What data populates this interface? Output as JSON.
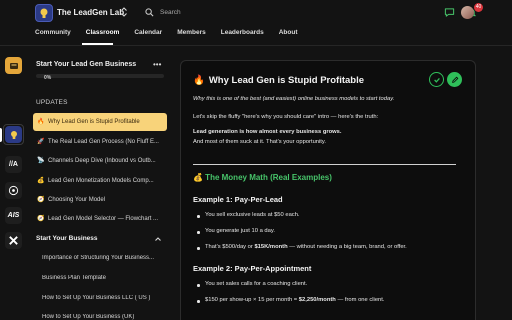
{
  "header": {
    "brand": "The LeadGen Lab",
    "search_placeholder": "Search",
    "notification_count": "40"
  },
  "nav": {
    "tabs": [
      "Community",
      "Classroom",
      "Calendar",
      "Members",
      "Leaderboards",
      "About"
    ],
    "active": "Classroom"
  },
  "rail": {
    "items": [
      {
        "icon": "course-badge-icon",
        "color": "#e4a63a"
      },
      {
        "icon": "leadgen-lab-icon",
        "color": "#2b3a86"
      },
      {
        "label": "//A",
        "color": "#1e1e1e"
      },
      {
        "icon": "grid-logo-icon",
        "color": "#1e1e1e"
      },
      {
        "label": "AIS",
        "color": "#1e1e1e"
      },
      {
        "icon": "x-logo-icon",
        "color": "#1e1e1e"
      }
    ]
  },
  "course": {
    "title": "Start Your Lead Gen Business",
    "progress": 0,
    "progress_label": "0%",
    "updates_label": "UPDATES",
    "lessons": [
      {
        "emoji": "🔥",
        "label": "Why Lead Gen is Stupid Profitable",
        "active": true
      },
      {
        "emoji": "🚀",
        "label": "The Real Lead Gen Process (No Fluff E..."
      },
      {
        "emoji": "📡",
        "label": "Channels Deep Dive (Inbound vs Outb..."
      },
      {
        "emoji": "💰",
        "label": "Lead Gen Monetization Models Comp..."
      },
      {
        "emoji": "🧭",
        "label": "Choosing Your Model"
      },
      {
        "emoji": "🧭",
        "label": "Lead Gen Model Selector — Flowchart ..."
      }
    ],
    "section": {
      "title": "Start Your Business",
      "items": [
        "Importance of Structuring Your Business...",
        "Business Plan Template",
        "How to Set Up Your Business LLC ( US )",
        "How to Set Up Your Business (UK)"
      ]
    }
  },
  "content": {
    "title_emoji": "🔥",
    "title": "Why Lead Gen is Stupid Profitable",
    "intro_italic": "Why this is one of the best (and easiest) online business models to start today.",
    "intro_line": "Let's skip the fluffy \"here's why you should care\" intro — here's the truth:",
    "bold_line": "Lead generation is how almost every business grows.",
    "follow_line": "And most of them suck at it. That's your opportunity.",
    "money_heading": "💰 The Money Math (Real Examples)",
    "example1": {
      "heading": "Example 1: Pay-Per-Lead",
      "bullets": [
        "You sell exclusive leads at $50 each.",
        "You generate just 10 a day."
      ],
      "last_prefix": "That's $500/day or ",
      "last_bold": "$15K/month",
      "last_suffix": " — without needing a big team, brand, or offer."
    },
    "example2": {
      "heading": "Example 2: Pay-Per-Appointment",
      "bullet1": "You set sales calls for a coaching client.",
      "bullet2_prefix": "$150 per show-up × 15 per month = ",
      "bullet2_bold": "$2,250/month",
      "bullet2_suffix": " — from one client."
    }
  },
  "colors": {
    "accent_green": "#2fbf5a",
    "active_lesson": "#f8d37a",
    "badge_red": "#d9343b"
  }
}
